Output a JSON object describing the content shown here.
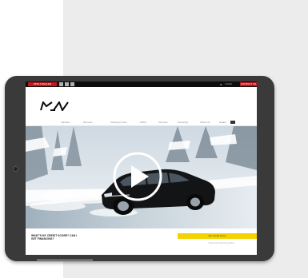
{
  "topbar": {
    "dealer_label": "FIND A DEALER",
    "login_label": "LOGIN",
    "contact_label": "CONTACT US"
  },
  "brand": {
    "logo_text": "KIA"
  },
  "nav": {
    "items": [
      "Vehicles",
      "Discover",
      "Shopping Tools",
      "Offers",
      "Services",
      "Financing",
      "About Us",
      "Dealer"
    ]
  },
  "hero": {
    "play_label": "Play video"
  },
  "bottom": {
    "tagline": "WHAT’S MY CREDIT SCORE? CAN I GET FINANCING?",
    "cta_label": "Get Credit Score",
    "fineprint": "Powered by financing partner"
  },
  "colors": {
    "accent": "#c4161c",
    "cta": "#f2d200",
    "bezel": "#3a3a3a"
  }
}
